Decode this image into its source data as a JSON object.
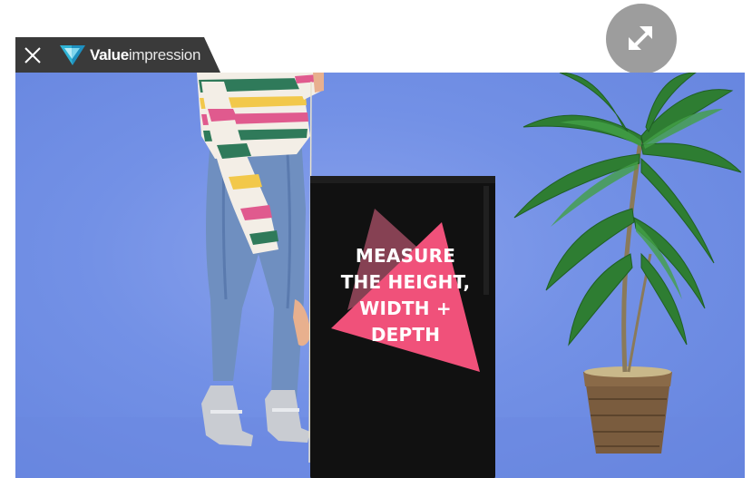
{
  "player": {
    "close_icon": "close-icon",
    "expand_icon": "expand-arrows-icon",
    "brand": {
      "name_strong": "Value",
      "name_light": "impression",
      "logo_icon": "valueimpression-logo-icon"
    }
  },
  "video": {
    "caption_lines": [
      "MEASURE",
      "THE HEIGHT,",
      "WIDTH +",
      "DEPTH"
    ]
  },
  "colors": {
    "brand_bar": "#3a3a3a",
    "background": "#7391e6",
    "accent_pink": "#f0517a",
    "fridge": "#111111",
    "expand_button": "#9d9d9d"
  }
}
